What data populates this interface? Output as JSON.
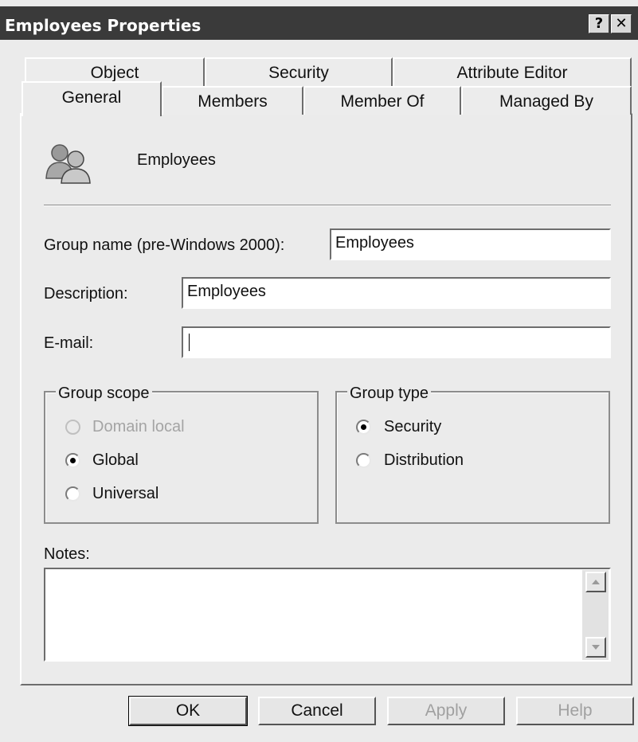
{
  "window": {
    "title": "Employees Properties",
    "help_glyph": "?",
    "close_glyph": "✕"
  },
  "tabs": {
    "row_back": [
      "Object",
      "Security",
      "Attribute Editor"
    ],
    "row_front": [
      "General",
      "Members",
      "Member Of",
      "Managed By"
    ],
    "selected": "General"
  },
  "header": {
    "icon": "group-users-icon",
    "group_display_name": "Employees"
  },
  "form": {
    "pre2000_label": "Group name (pre-Windows 2000):",
    "pre2000_value": "Employees",
    "description_label": "Description:",
    "description_value": "Employees",
    "email_label": "E-mail:",
    "email_value": ""
  },
  "group_scope": {
    "legend": "Group scope",
    "options": [
      {
        "label": "Domain local",
        "checked": false,
        "enabled": false
      },
      {
        "label": "Global",
        "checked": true,
        "enabled": true
      },
      {
        "label": "Universal",
        "checked": false,
        "enabled": true
      }
    ]
  },
  "group_type": {
    "legend": "Group type",
    "options": [
      {
        "label": "Security",
        "checked": true,
        "enabled": true
      },
      {
        "label": "Distribution",
        "checked": false,
        "enabled": true
      }
    ]
  },
  "notes": {
    "label": "Notes:",
    "value": ""
  },
  "buttons": {
    "ok": "OK",
    "cancel": "Cancel",
    "apply": "Apply",
    "help": "Help"
  }
}
